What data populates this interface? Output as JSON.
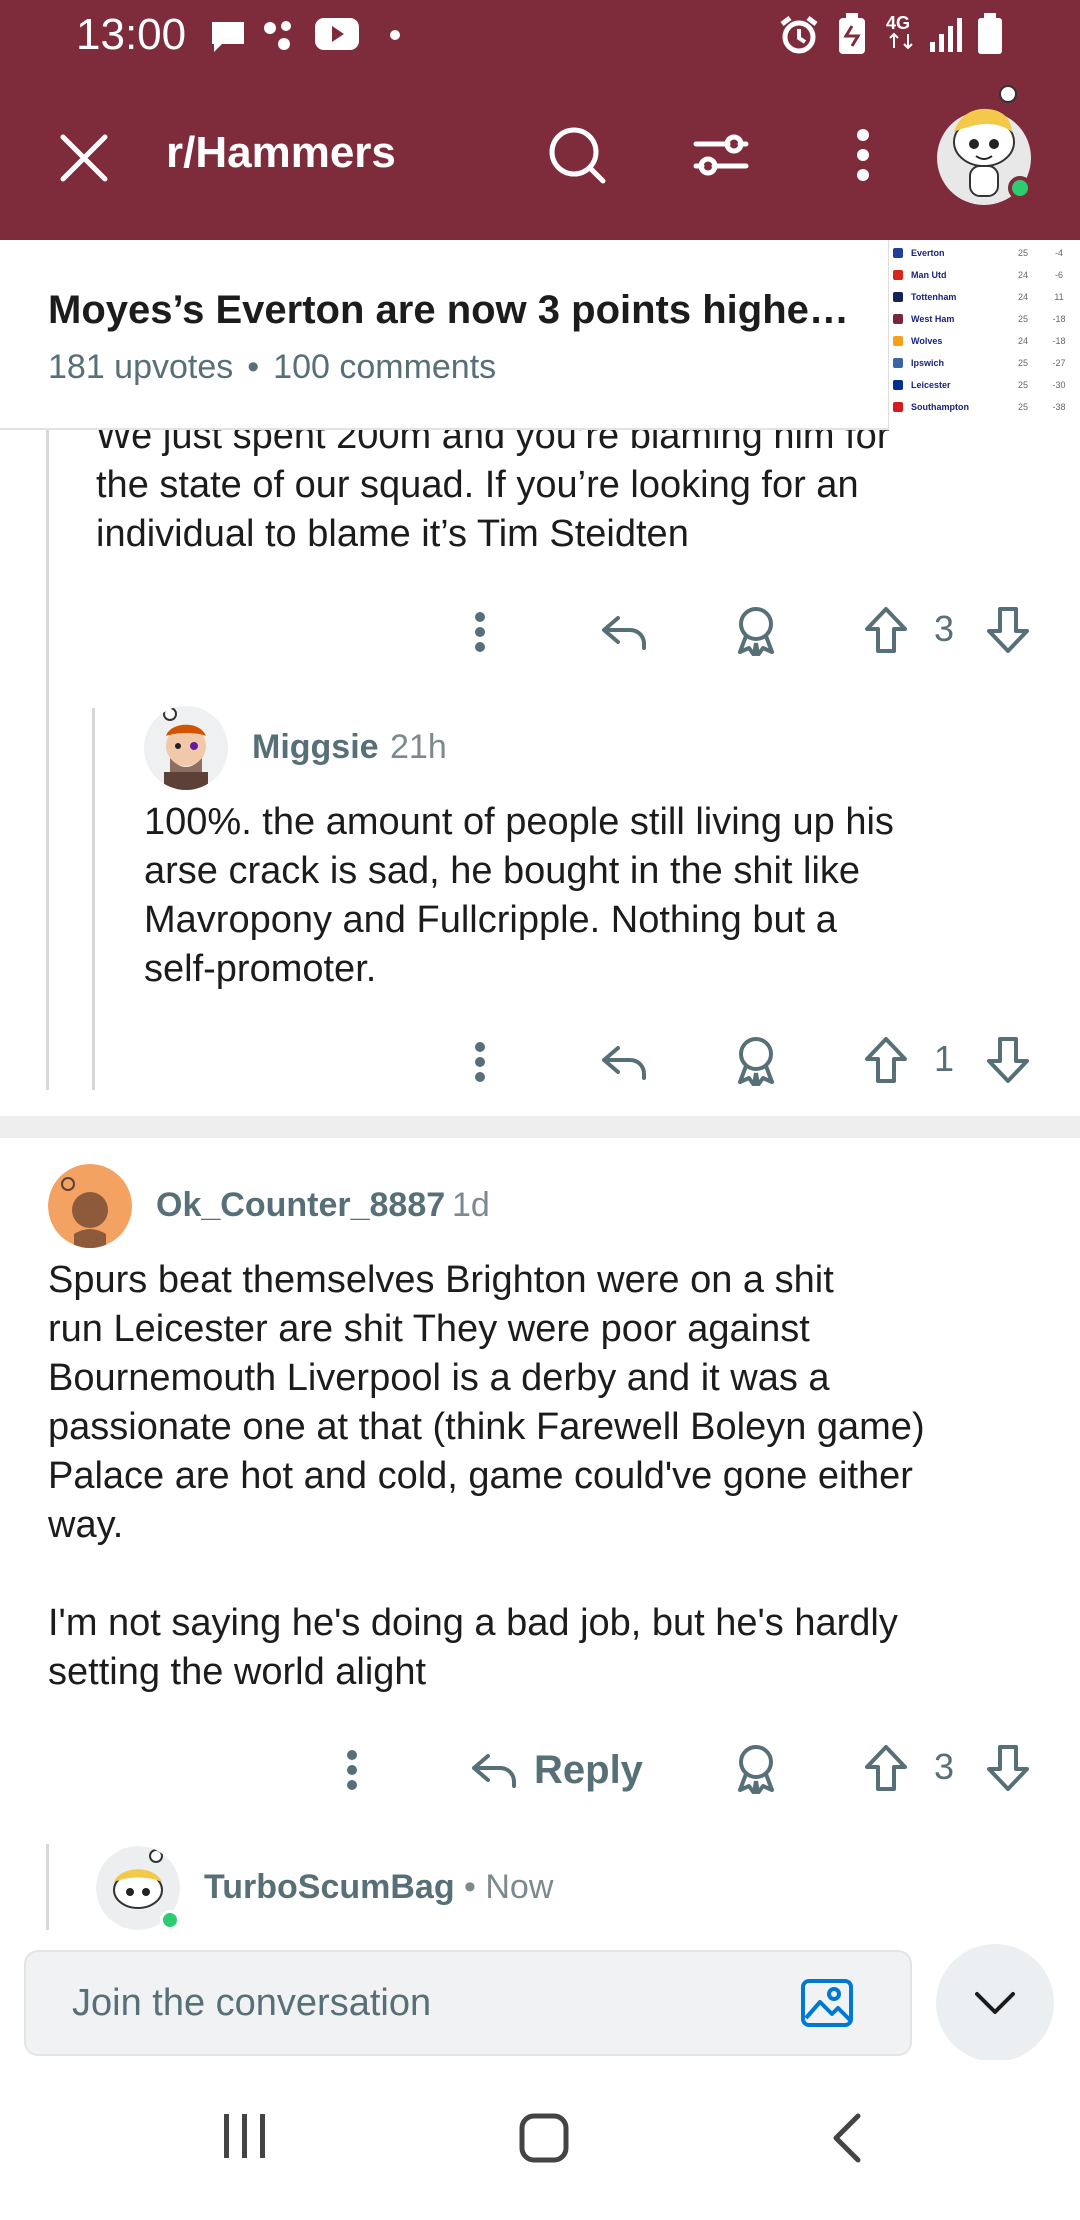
{
  "status_bar": {
    "time": "13:00",
    "network": "4G",
    "icons": [
      "message-icon",
      "dots-icon",
      "youtube-icon",
      "dot-icon",
      "alarm-icon",
      "battery-saver-icon",
      "network-icon",
      "signal-icon",
      "battery-icon"
    ]
  },
  "app_bar": {
    "subreddit": "r/Hammers",
    "icons": [
      "close-icon",
      "search-icon",
      "filter-icon",
      "more-icon",
      "avatar"
    ]
  },
  "post": {
    "title": "Moyes’s Everton are now 3 points highe…",
    "upvotes": "181 upvotes",
    "separator": "•",
    "comments": "100 comments",
    "thumbnail_table": [
      {
        "team": "Everton",
        "played": "25",
        "gd": "-4",
        "color": "#1f3f99"
      },
      {
        "team": "Man Utd",
        "played": "24",
        "gd": "-6",
        "color": "#d7261e"
      },
      {
        "team": "Tottenham",
        "played": "24",
        "gd": "11",
        "color": "#132257"
      },
      {
        "team": "West Ham",
        "played": "25",
        "gd": "-18",
        "color": "#7a263a"
      },
      {
        "team": "Wolves",
        "played": "24",
        "gd": "-18",
        "color": "#f9a01b"
      },
      {
        "team": "Ipswich",
        "played": "25",
        "gd": "-27",
        "color": "#3a64a3"
      },
      {
        "team": "Leicester",
        "played": "25",
        "gd": "-30",
        "color": "#003090"
      },
      {
        "team": "Southampton",
        "played": "25",
        "gd": "-38",
        "color": "#d71920"
      }
    ]
  },
  "comments": [
    {
      "id": "c1",
      "text": "We just spent 200m and you’re blaming him for\nthe state of our squad. If you’re looking for an\nindividual to blame it’s Tim Steidten",
      "votes": "3"
    },
    {
      "id": "c2",
      "author": "Miggsie",
      "time": "21h",
      "text": "100%. the amount of people still living up his\narse crack is sad, he bought in the shit like\nMavropony and Fullcripple. Nothing but a\nself-promoter.",
      "votes": "1"
    },
    {
      "id": "c3",
      "author": "Ok_Counter_8887",
      "time": "1d",
      "text": "Spurs beat themselves Brighton were on a shit\nrun Leicester are shit They were poor against\nBournemouth Liverpool is a derby and it was a\npassionate one at that (think Farewell Boleyn game)\nPalace are hot and cold, game could've gone either\nway.\n\nI'm not saying he's doing a bad job, but he's hardly\nsetting the world alight",
      "reply_label": "Reply",
      "votes": "3"
    },
    {
      "id": "c4",
      "author": "TurboScumBag",
      "time": "• Now"
    }
  ],
  "composer": {
    "placeholder": "Join the conversation"
  },
  "colors": {
    "brand": "#7e2b3c",
    "meta_text": "#576f76",
    "online": "#2ecc71"
  }
}
